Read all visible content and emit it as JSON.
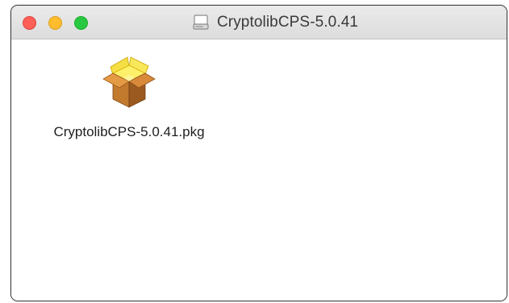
{
  "window": {
    "title": "CryptolibCPS-5.0.41",
    "title_icon": "disk-image-icon"
  },
  "traffic_lights": {
    "close_color": "#fe5f57",
    "minimize_color": "#febc2e",
    "zoom_color": "#28c840"
  },
  "files": [
    {
      "name": "CryptolibCPS-5.0.41.pkg",
      "icon": "package-icon"
    }
  ]
}
